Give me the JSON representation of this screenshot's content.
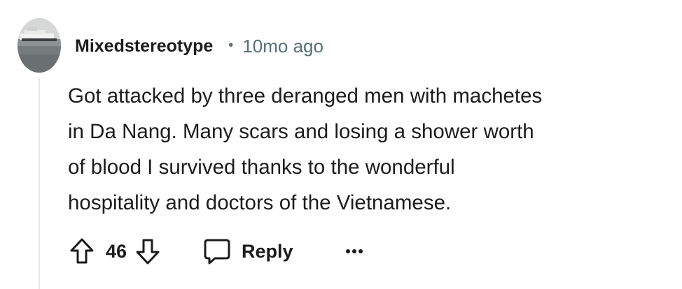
{
  "comment": {
    "author": "Mixedstereotype",
    "separator": "•",
    "time_ago": "10mo ago",
    "body_lines": [
      "Got attacked by three deranged men with machetes",
      "in Da Nang. Many scars and losing a shower worth",
      "of blood I survived thanks to the wonderful",
      "hospitality and doctors of the Vietnamese."
    ]
  },
  "actions": {
    "upvote_icon": "arrow-up-outline-icon",
    "score": "46",
    "downvote_icon": "arrow-down-outline-icon",
    "reply_icon": "speech-bubble-icon",
    "reply_label": "Reply",
    "more_icon": "ellipsis-icon"
  },
  "colors": {
    "text": "#1c1c1c",
    "meta": "#576f76",
    "thread_line": "#e5e7ea"
  }
}
